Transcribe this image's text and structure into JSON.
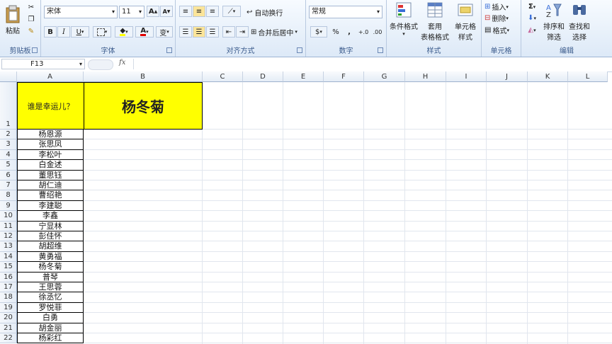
{
  "ribbon": {
    "clipboard": {
      "paste_label": "粘贴",
      "group_label": "剪贴板"
    },
    "font": {
      "font_name": "宋体",
      "font_size": "11",
      "grow_label": "A",
      "shrink_label": "A",
      "bold": "B",
      "italic": "I",
      "underline": "U",
      "font_color_label": "A",
      "phonetic_label": "变",
      "group_label": "字体"
    },
    "alignment": {
      "wrap_label": "自动换行",
      "merge_label": "合并后居中",
      "group_label": "对齐方式"
    },
    "number": {
      "format_value": "常规",
      "currency": "$",
      "percent": "%",
      "comma": ",",
      "inc_decimal": "+.0",
      "dec_decimal": ".00",
      "group_label": "数字"
    },
    "styles": {
      "conditional_label": "条件格式",
      "table_label_1": "套用",
      "table_label_2": "表格格式",
      "cell_style_label_1": "单元格",
      "cell_style_label_2": "样式",
      "group_label": "样式"
    },
    "cells": {
      "insert_label": "插入",
      "delete_label": "删除",
      "format_label": "格式",
      "group_label": "单元格"
    },
    "editing": {
      "sum_label": "Σ",
      "sort_label_1": "排序和",
      "sort_label_2": "筛选",
      "find_label_1": "查找和",
      "find_label_2": "选择",
      "group_label": "编辑"
    }
  },
  "formula_bar": {
    "name_box": "F13",
    "fx_label": "fx",
    "value": ""
  },
  "columns": [
    "A",
    "B",
    "C",
    "D",
    "E",
    "F",
    "G",
    "H",
    "I",
    "J",
    "K",
    "L"
  ],
  "rows": [
    "1",
    "2",
    "3",
    "4",
    "5",
    "6",
    "7",
    "8",
    "9",
    "10",
    "11",
    "12",
    "13",
    "14",
    "15",
    "16",
    "17",
    "18",
    "19",
    "20",
    "21",
    "22"
  ],
  "sheet": {
    "a1": "谁是幸运儿？",
    "b1": "杨冬菊",
    "names": [
      "杨恩源",
      "张思凤",
      "李松叶",
      "白金述",
      "董思钰",
      "胡仁迪",
      "曹绍艳",
      "李建聪",
      "李鑫",
      "宁显林",
      "彭佳怀",
      "胡超维",
      "黄勇福",
      "杨冬菊",
      "普琴",
      "王思蓉",
      "徐丞忆",
      "罗悦菲",
      "白勇",
      "胡金丽",
      "杨彩红"
    ]
  },
  "colors": {
    "highlight_fill": "#ffff00",
    "ribbon_label": "#3b5b8c"
  }
}
